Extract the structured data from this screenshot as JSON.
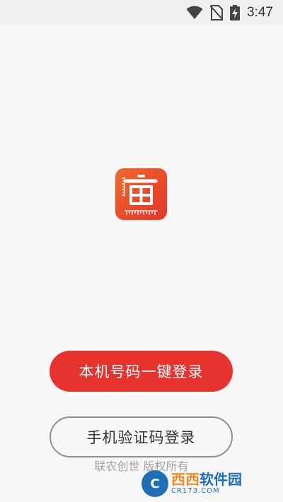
{
  "status_bar": {
    "time": "3:47"
  },
  "logo": {
    "glyph": "亩"
  },
  "actions": {
    "one_click_login": "本机号码一键登录",
    "sms_login": "手机验证码登录"
  },
  "footer": {
    "copyright": "联农创世 版权所有"
  },
  "watermark": {
    "name_left": "西西",
    "name_right": "软件园",
    "domain": "CR173.COM"
  },
  "colors": {
    "primary": "#e8322e",
    "logo": "#e94a2a",
    "background": "#f7f7f7"
  }
}
